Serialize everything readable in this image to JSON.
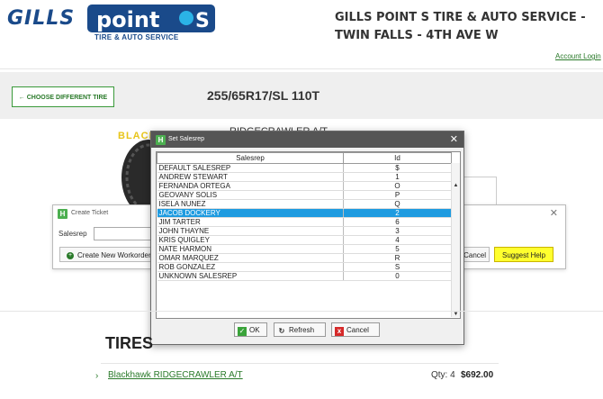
{
  "header": {
    "brand_gills": "GILLS",
    "brand_points": "point S",
    "brand_tagline": "TIRE & AUTO SERVICE",
    "store_title": "GILLS POINT S TIRE & AUTO SERVICE - TWIN FALLS - 4TH AVE W",
    "account_login": "Account Login"
  },
  "toolbar": {
    "choose_tire": "← CHOOSE DIFFERENT TIRE",
    "tire_size": "255/65R17/SL 110T"
  },
  "product": {
    "brand_logo": "BLACKHAWK",
    "name_partial": "RIDGECRAWLER A/T"
  },
  "create_ticket": {
    "title": "Create Ticket",
    "salesrep_label": "Salesrep",
    "new_workorder": "Create New Workorder",
    "cancel": "Cancel",
    "suggest_help": "Suggest Help"
  },
  "dialog": {
    "title": "Set Salesrep",
    "columns": [
      "Salesrep",
      "Id"
    ],
    "rows": [
      {
        "name": "DEFAULT SALESREP",
        "id": "$"
      },
      {
        "name": "ANDREW STEWART",
        "id": "1"
      },
      {
        "name": "FERNANDA ORTEGA",
        "id": "O"
      },
      {
        "name": "GEOVANY SOLIS",
        "id": "P"
      },
      {
        "name": "ISELA NUNEZ",
        "id": "Q"
      },
      {
        "name": "JACOB DOCKERY",
        "id": "2"
      },
      {
        "name": "JIM TARTER",
        "id": "6"
      },
      {
        "name": "JOHN THAYNE",
        "id": "3"
      },
      {
        "name": "KRIS QUIGLEY",
        "id": "4"
      },
      {
        "name": "NATE HARMON",
        "id": "5"
      },
      {
        "name": "OMAR MARQUEZ",
        "id": "R"
      },
      {
        "name": "ROB GONZALEZ",
        "id": "S"
      },
      {
        "name": "UNKNOWN SALESREP",
        "id": "0"
      }
    ],
    "selected_row": "JACOB DOCKERY",
    "buttons": {
      "ok": "OK",
      "refresh": "Refresh",
      "cancel": "Cancel"
    }
  },
  "cart": {
    "heading": "TIRES",
    "item_name": "Blackhawk RIDGECRAWLER A/T",
    "item_qty": "Qty: 4",
    "item_price": "$692.00"
  },
  "colors": {
    "brand_blue": "#1a4a8a",
    "accent_green": "#2a7a2a",
    "selection_blue": "#1e9be0",
    "suggest_yellow": "#ffff2e"
  }
}
